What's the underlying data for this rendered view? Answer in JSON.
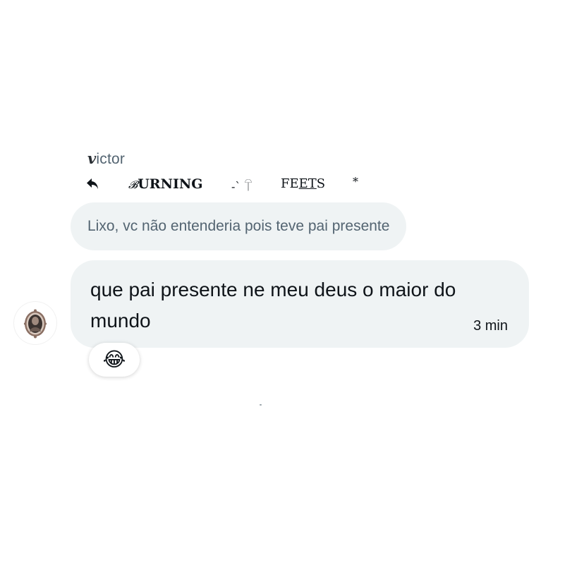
{
  "sender": {
    "name_first_letter": "𝒗",
    "name_rest": "ictor"
  },
  "reply_context": {
    "icon": "reply-arrow-icon",
    "replied_to_b": "𝓑",
    "replied_to_rest": "URNING",
    "deco": "-` 𓋼",
    "feets_start": "FE",
    "feets_underlined": "ET",
    "feets_end": "S",
    "star": "*"
  },
  "quoted_message": {
    "text": "Lixo, vc não entenderia pois teve pai presente"
  },
  "message": {
    "text": "que pai presente ne meu deus o maior do mundo",
    "time": "3 min",
    "avatar": "framed-portrait-avatar"
  },
  "reaction": {
    "emoji": "😂",
    "icon": "laughing-tears-emoji-icon"
  },
  "colors": {
    "bubble_bg": "#eff3f4",
    "muted_text": "#536471",
    "text": "#0f1419"
  }
}
